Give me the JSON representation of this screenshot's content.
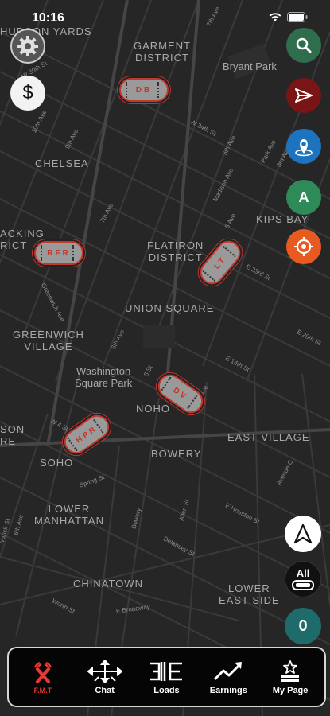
{
  "status_bar": {
    "time": "10:16"
  },
  "map": {
    "areas": [
      {
        "id": "hudson-yards",
        "text": "HUDSON YARDS"
      },
      {
        "id": "garment-district",
        "text": "GARMENT\nDISTRICT"
      },
      {
        "id": "bryant-park",
        "text": "Bryant Park"
      },
      {
        "id": "chelsea",
        "text": "CHELSEA"
      },
      {
        "id": "kips-bay",
        "text": "KIPS BAY"
      },
      {
        "id": "flatiron",
        "text": "FLATIRON\nDISTRICT"
      },
      {
        "id": "packing",
        "text": "ACKING\nRICT"
      },
      {
        "id": "union-square",
        "text": "UNION SQUARE"
      },
      {
        "id": "greenwich",
        "text": "GREENWICH\nVILLAGE"
      },
      {
        "id": "washington-sq",
        "text": "Washington\nSquare Park"
      },
      {
        "id": "noho",
        "text": "NOHO"
      },
      {
        "id": "east-village",
        "text": "EAST VILLAGE"
      },
      {
        "id": "hudson-son",
        "text": "SON\nRE"
      },
      {
        "id": "soho",
        "text": "SOHO"
      },
      {
        "id": "bowery",
        "text": "BOWERY"
      },
      {
        "id": "lower-manhattan",
        "text": "LOWER\nMANHATTAN"
      },
      {
        "id": "chinatown",
        "text": "CHINATOWN"
      },
      {
        "id": "lower-east-side",
        "text": "LOWER\nEAST SIDE"
      }
    ],
    "streets": {
      "w30": "W 30th St",
      "10ave": "10th Ave",
      "9ave": "9th Ave",
      "7ave_top": "7th Ave",
      "w34": "W 34th St",
      "madison": "Madison Ave",
      "5ave_top": "5th Ave",
      "park": "Park Ave",
      "3ave_top": "3rd Ave",
      "7ave": "7th Ave",
      "5ave": "5 Ave",
      "e23": "E 23rd St",
      "e20": "E 20th St",
      "greenwich_ave": "Greenwich Ave",
      "6ave": "6th Ave",
      "e14": "E 14th St",
      "8st": "8 St",
      "w4": "W 4 St",
      "2ave": "2nd Ave",
      "ave_c": "Avenue C",
      "spring": "Spring St",
      "e_houston": "E Houston St",
      "varick": "Varick St",
      "6ave_low": "6th Ave",
      "bowery_st": "Bowery",
      "allen": "Allen St",
      "delancey": "Delancey St",
      "worth": "Worth St",
      "e_broadway": "E Broadway"
    }
  },
  "vehicles": [
    {
      "label": "DB"
    },
    {
      "label": "RFR"
    },
    {
      "label": "LT"
    },
    {
      "label": "DV"
    },
    {
      "label": "HPR"
    }
  ],
  "controls": {
    "dollar": "$",
    "location_badge": "A",
    "all_label": "All",
    "counter": "0"
  },
  "colors": {
    "search": "#2f6e4d",
    "send": "#7a1515",
    "gps": "#1e73be",
    "a_badge": "#2e8b57",
    "target": "#e85a20",
    "counter": "#1d6b6b",
    "accent_red": "#e53935"
  },
  "nav": [
    {
      "id": "fmt",
      "label": "F.M.T",
      "icon": "alarm-x-icon",
      "active": true
    },
    {
      "id": "chat",
      "label": "Chat",
      "icon": "move-arrows-icon",
      "active": false
    },
    {
      "id": "loads",
      "label": "Loads",
      "icon": "loads-icon",
      "active": false
    },
    {
      "id": "earnings",
      "label": "Earnings",
      "icon": "trend-up-icon",
      "active": false
    },
    {
      "id": "mypage",
      "label": "My Page",
      "icon": "star-podium-icon",
      "active": false
    }
  ]
}
